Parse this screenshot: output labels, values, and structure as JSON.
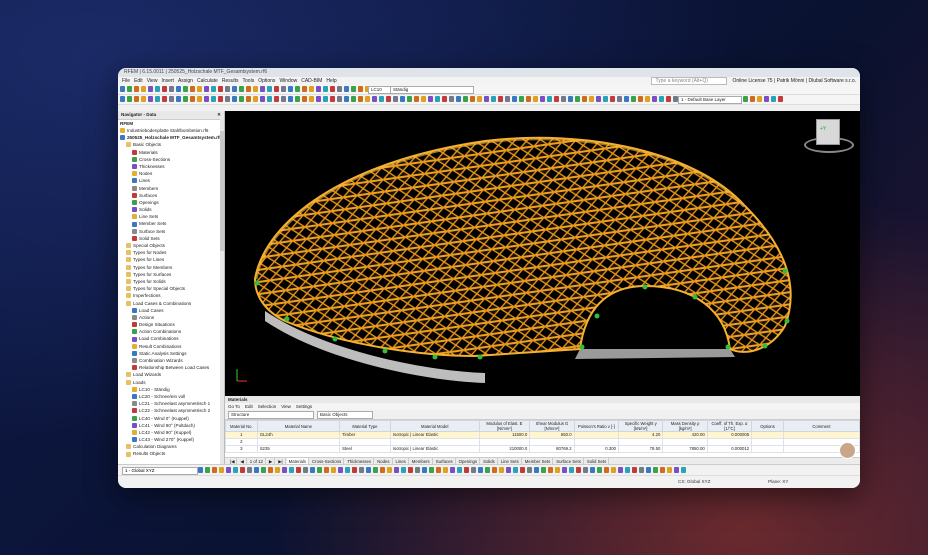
{
  "window": {
    "title": "RFEM | 6.15.0011 | 250525_Holzschale MTF_Gesamtsystem.rf6",
    "menu": [
      "File",
      "Edit",
      "View",
      "Insert",
      "Assign",
      "Calculate",
      "Results",
      "Tools",
      "Options",
      "Window",
      "CAD-BIM",
      "Help"
    ],
    "search_placeholder": "Type a keyword (Alt+Q)",
    "license": "Online License 75 | Patrik Mönni | Dlubal Software s.r.o."
  },
  "toolbar": {
    "load_case_code": "LC10",
    "load_case_name": "Ständig",
    "layer": "1 - Default Base Layer"
  },
  "navigator": {
    "title": "Navigator - Data",
    "section": "RFEM",
    "items": [
      {
        "label": "Industriebodenplatte Stahlbombetion.rf6",
        "level": 0
      },
      {
        "label": "250525_Holzschale MTF_Gesamtsystem.rf6",
        "level": 0,
        "bold": true
      },
      {
        "label": "Basic Objects",
        "level": 1
      },
      {
        "label": "Materials",
        "level": 2
      },
      {
        "label": "Cross-Sections",
        "level": 2
      },
      {
        "label": "Thicknesses",
        "level": 2
      },
      {
        "label": "Nodes",
        "level": 2
      },
      {
        "label": "Lines",
        "level": 2
      },
      {
        "label": "Members",
        "level": 2
      },
      {
        "label": "Surfaces",
        "level": 2
      },
      {
        "label": "Openings",
        "level": 2
      },
      {
        "label": "Solids",
        "level": 2
      },
      {
        "label": "Line Sets",
        "level": 2
      },
      {
        "label": "Member Sets",
        "level": 2
      },
      {
        "label": "Surface Sets",
        "level": 2
      },
      {
        "label": "Solid Sets",
        "level": 2
      },
      {
        "label": "Special Objects",
        "level": 1
      },
      {
        "label": "Types for Nodes",
        "level": 1
      },
      {
        "label": "Types for Lines",
        "level": 1
      },
      {
        "label": "Types for Members",
        "level": 1
      },
      {
        "label": "Types for Surfaces",
        "level": 1
      },
      {
        "label": "Types for Solids",
        "level": 1
      },
      {
        "label": "Types for Special Objects",
        "level": 1
      },
      {
        "label": "Imperfections",
        "level": 1
      },
      {
        "label": "Load Cases & Combinations",
        "level": 1
      },
      {
        "label": "Load Cases",
        "level": 2
      },
      {
        "label": "Actions",
        "level": 2
      },
      {
        "label": "Design Situations",
        "level": 2
      },
      {
        "label": "Action Combinations",
        "level": 2
      },
      {
        "label": "Load Combinations",
        "level": 2
      },
      {
        "label": "Result Combinations",
        "level": 2
      },
      {
        "label": "Static Analysis Settings",
        "level": 2
      },
      {
        "label": "Combination Wizards",
        "level": 2
      },
      {
        "label": "Relationship Between Load Cases",
        "level": 2
      },
      {
        "label": "Load Wizards",
        "level": 1
      },
      {
        "label": "Loads",
        "level": 1
      },
      {
        "label": "LC10 - Ständig",
        "level": 2
      },
      {
        "label": "LC20 - Schnee/ein voll",
        "level": 2
      },
      {
        "label": "LC21 - Schneelast asymmetrisch 1",
        "level": 2
      },
      {
        "label": "LC22 - Schneelast asymmetrisch 2",
        "level": 2
      },
      {
        "label": "LC40 - Wind 0° (Kuppel)",
        "level": 2
      },
      {
        "label": "LC41 - Wind 90° (Pultdach)",
        "level": 2
      },
      {
        "label": "LC42 - Wind 90° (Kuppel)",
        "level": 2
      },
      {
        "label": "LC43 - Wind 270° (Kuppel)",
        "level": 2
      },
      {
        "label": "Calculation Diagrams",
        "level": 1
      },
      {
        "label": "Results Objects",
        "level": 1
      }
    ]
  },
  "viewcube": {
    "label": "+Y"
  },
  "bottom": {
    "title": "Materials",
    "menu": [
      "Go To",
      "Edit",
      "Selection",
      "View",
      "Settings"
    ],
    "filter": "Structure",
    "basic_objects": "Basic Objects",
    "columns": [
      "Material No.",
      "Material Name",
      "Material Type",
      "Material Model",
      "Modulus of Elast. E [N/mm²]",
      "Shear Modulus G [N/mm²]",
      "Poisson's Ratio ν [-]",
      "Specific Weight γ [kN/m³]",
      "Mass Density ρ [kg/m³]",
      "Coeff. of Th. Exp. α [1/°C]",
      "Options",
      "Comment"
    ],
    "rows": [
      {
        "no": "1",
        "name": "GL24h",
        "type": "Timber",
        "model": "Isotropic | Linear Elastic",
        "e": "11500.0",
        "g": "650.0",
        "nu": "",
        "w": "4.20",
        "rho": "420.00",
        "alpha": "0.000005"
      },
      {
        "no": "2",
        "name": "",
        "type": "",
        "model": "",
        "e": "",
        "g": "",
        "nu": "",
        "w": "",
        "rho": "",
        "alpha": ""
      },
      {
        "no": "3",
        "name": "S235",
        "type": "Steel",
        "model": "Isotropic | Linear Elastic",
        "e": "210000.0",
        "g": "80769.2",
        "nu": "0.300",
        "w": "78.50",
        "rho": "7850.00",
        "alpha": "0.000012"
      }
    ],
    "pager": "1 of 12",
    "tabs": [
      "Materials",
      "Cross-Sections",
      "Thicknesses",
      "Nodes",
      "Lines",
      "Members",
      "Surfaces",
      "Openings",
      "Solids",
      "Line Sets",
      "Member Sets",
      "Surface Sets",
      "Solid Sets"
    ]
  },
  "status": {
    "cs": "CS: Global XYZ",
    "plane": "Plane: XY",
    "left_select": "1 - Global XYZ"
  },
  "colors": {
    "timber": "#f0a020",
    "support": "#2fbf3a",
    "viewport_bg": "#000000"
  }
}
